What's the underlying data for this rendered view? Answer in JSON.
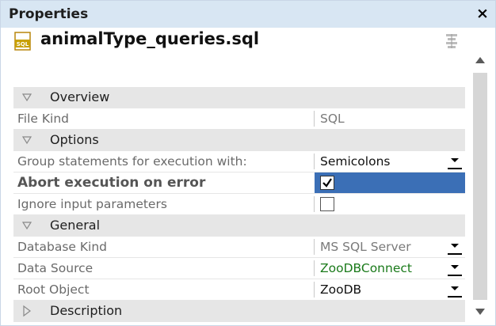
{
  "panel": {
    "title": "Properties",
    "close_glyph": "×"
  },
  "file": {
    "name": "animalType_queries.sql",
    "icon": "sql-file-icon",
    "icon_text": "SQL"
  },
  "sections": {
    "overview": {
      "title": "Overview"
    },
    "options": {
      "title": "Options"
    },
    "general": {
      "title": "General"
    },
    "description": {
      "title": "Description"
    }
  },
  "rows": {
    "file_kind": {
      "label": "File Kind",
      "value": "SQL"
    },
    "group_statements": {
      "label": "Group statements for execution with:",
      "value": "Semicolons"
    },
    "abort_on_error": {
      "label": "Abort execution on error",
      "checked": true
    },
    "ignore_input": {
      "label": "Ignore input parameters",
      "checked": false
    },
    "database_kind": {
      "label": "Database Kind",
      "value": "MS SQL Server"
    },
    "data_source": {
      "label": "Data Source",
      "value": "ZooDBConnect"
    },
    "root_object": {
      "label": "Root Object",
      "value": "ZooDB"
    }
  },
  "colors": {
    "titlebar": "#d8e6f3",
    "section": "#e6e6e6",
    "selected": "#3b6fb6",
    "datasource_green": "#1a7a1a"
  }
}
